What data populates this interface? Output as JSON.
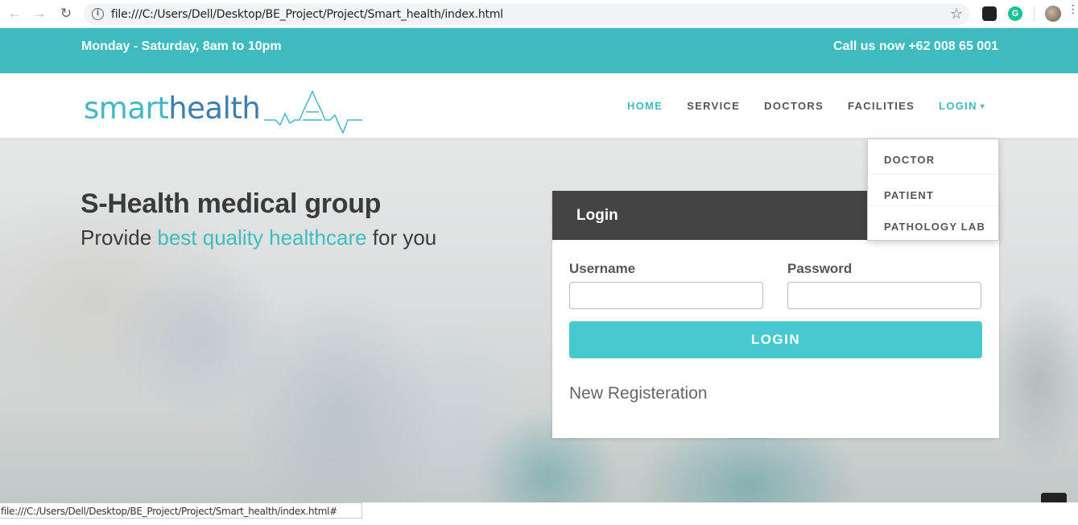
{
  "browser": {
    "url": "file:///C:/Users/Dell/Desktop/BE_Project/Project/Smart_health/index.html",
    "status_url": "file:///C:/Users/Dell/Desktop/BE_Project/Project/Smart_health/index.html#"
  },
  "topbar": {
    "hours": "Monday - Saturday, 8am to 10pm",
    "phone": "Call us now +62 008 65 001"
  },
  "logo": {
    "part1": "smart",
    "part2": "health"
  },
  "nav": {
    "home": "HOME",
    "service": "SERVICE",
    "doctors": "DOCTORS",
    "facilities": "FACILITIES",
    "login": "LOGIN"
  },
  "dropdown": {
    "items": [
      "DOCTOR",
      "PATIENT",
      "PATHOLOGY LAB"
    ]
  },
  "hero": {
    "title": "S-Health medical group",
    "sub_pre": "Provide ",
    "sub_accent": "best quality healthcare",
    "sub_post": " for you"
  },
  "login_panel": {
    "title": "Login",
    "username_label": "Username",
    "password_label": "Password",
    "username_value": "",
    "password_value": "",
    "button": "LOGIN",
    "register_link": "New Registeration"
  },
  "colors": {
    "accent": "#3fbbc0",
    "dark_header": "#444444",
    "button": "#48c9cf"
  }
}
